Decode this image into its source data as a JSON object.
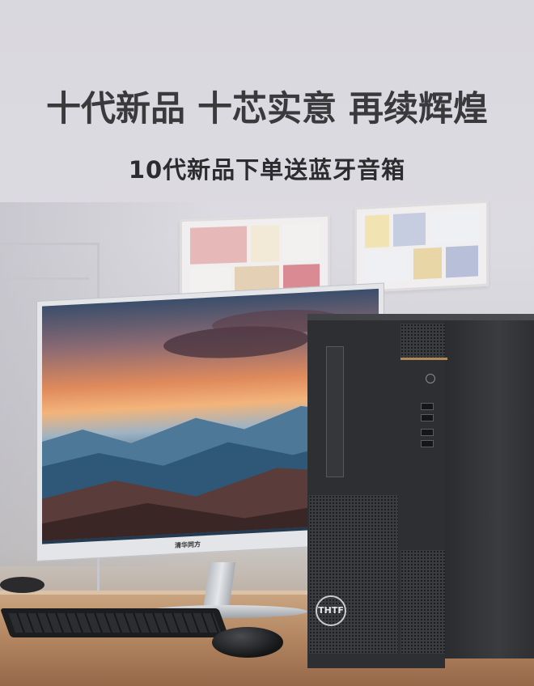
{
  "banner": {
    "headline": "十代新品 十芯实意 再续辉煌",
    "subline": "10代新品下单送蓝牙音箱"
  },
  "monitor": {
    "brand_label": "清华同方"
  },
  "tower": {
    "badge_label": "THTF"
  },
  "colors": {
    "headline": "#3a3a3c",
    "subline": "#2c2c2e",
    "tower_body": "#2d2f33",
    "accent_trim": "#b08a5a"
  }
}
